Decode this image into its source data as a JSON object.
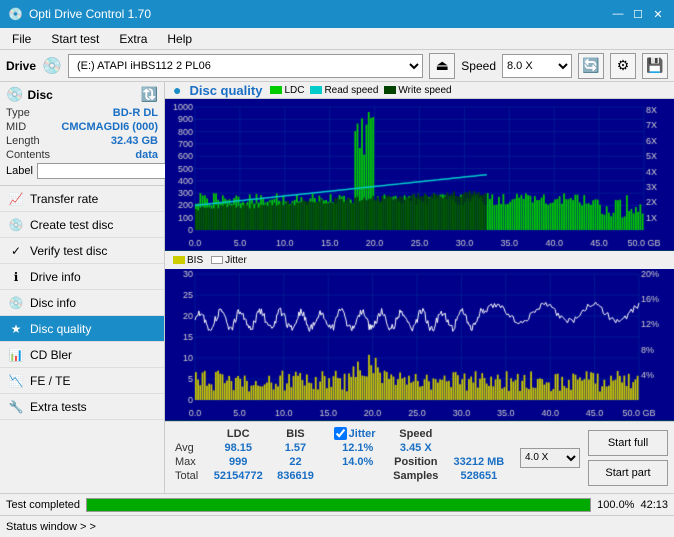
{
  "app": {
    "title": "Opti Drive Control 1.70",
    "icon": "💿"
  },
  "title_controls": {
    "minimize": "—",
    "maximize": "☐",
    "close": "✕"
  },
  "menu": {
    "items": [
      "File",
      "Start test",
      "Extra",
      "Help"
    ]
  },
  "drive_bar": {
    "label": "Drive",
    "drive_value": "(E:)  ATAPI iHBS112  2 PL06",
    "speed_label": "Speed",
    "speed_value": "8.0 X"
  },
  "disc": {
    "header": "Disc",
    "type_label": "Type",
    "type_val": "BD-R DL",
    "mid_label": "MID",
    "mid_val": "CMCMAGDI6 (000)",
    "length_label": "Length",
    "length_val": "32.43 GB",
    "contents_label": "Contents",
    "contents_val": "data",
    "label_label": "Label"
  },
  "nav": {
    "items": [
      {
        "id": "transfer-rate",
        "label": "Transfer rate",
        "icon": "📈"
      },
      {
        "id": "create-test-disc",
        "label": "Create test disc",
        "icon": "💿"
      },
      {
        "id": "verify-test-disc",
        "label": "Verify test disc",
        "icon": "✓"
      },
      {
        "id": "drive-info",
        "label": "Drive info",
        "icon": "ℹ"
      },
      {
        "id": "disc-info",
        "label": "Disc info",
        "icon": "💿"
      },
      {
        "id": "disc-quality",
        "label": "Disc quality",
        "icon": "★",
        "active": true
      },
      {
        "id": "cd-bler",
        "label": "CD Bler",
        "icon": "📊"
      },
      {
        "id": "fe-te",
        "label": "FE / TE",
        "icon": "📉"
      },
      {
        "id": "extra-tests",
        "label": "Extra tests",
        "icon": "🔧"
      }
    ]
  },
  "disc_quality": {
    "title": "Disc quality",
    "legend": {
      "ldc_label": "LDC",
      "ldc_color": "#00ff00",
      "read_speed_label": "Read speed",
      "read_speed_color": "#00ffff",
      "write_speed_label": "Write speed",
      "write_speed_color": "#008000",
      "bis_label": "BIS",
      "bis_color": "#ffff00",
      "jitter_label": "Jitter",
      "jitter_color": "#ffffff"
    }
  },
  "stats": {
    "headers": [
      "LDC",
      "BIS",
      "",
      "Jitter",
      "Speed",
      ""
    ],
    "avg_label": "Avg",
    "avg_ldc": "98.15",
    "avg_bis": "1.57",
    "avg_jitter": "12.1%",
    "avg_speed": "3.45 X",
    "max_label": "Max",
    "max_ldc": "999",
    "max_bis": "22",
    "max_jitter": "14.0%",
    "total_label": "Total",
    "total_ldc": "52154772",
    "total_bis": "836619",
    "position_label": "Position",
    "position_val": "33212 MB",
    "samples_label": "Samples",
    "samples_val": "528651",
    "speed_select": "4.0 X",
    "jitter_checked": true
  },
  "buttons": {
    "start_full": "Start full",
    "start_part": "Start part"
  },
  "status_bar": {
    "label": "Test completed",
    "progress": 100,
    "progress_text": "100.0%",
    "time": "42:13"
  },
  "status_window": {
    "label": "Status window > >"
  }
}
